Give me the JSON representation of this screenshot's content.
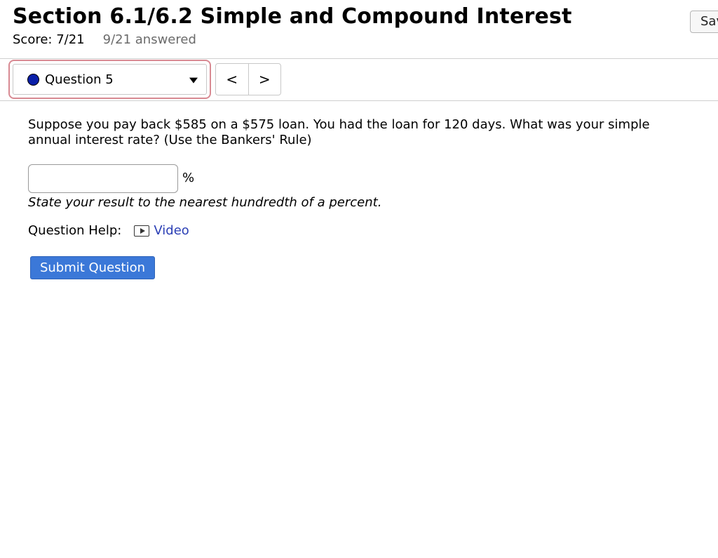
{
  "header": {
    "title": "Section 6.1/6.2 Simple and Compound Interest",
    "score": "Score: 7/21",
    "answered": "9/21 answered",
    "save_label": "Sav"
  },
  "navigation": {
    "question_selector": {
      "label": "Question 5",
      "status_color": "#0a1fa8"
    },
    "prev_symbol": "<",
    "next_symbol": ">"
  },
  "question": {
    "text": "Suppose you pay back $585 on a $575 loan. You had the loan for 120 days. What was your simple annual interest rate? (Use the Bankers' Rule)",
    "answer_value": "",
    "answer_unit": "%",
    "instruction": "State your result to the nearest hundredth of a percent."
  },
  "help": {
    "label": "Question Help:",
    "video_label": "Video",
    "video_icon": "video-play-icon"
  },
  "actions": {
    "submit_label": "Submit Question",
    "submit_color": "#3b78d8"
  }
}
